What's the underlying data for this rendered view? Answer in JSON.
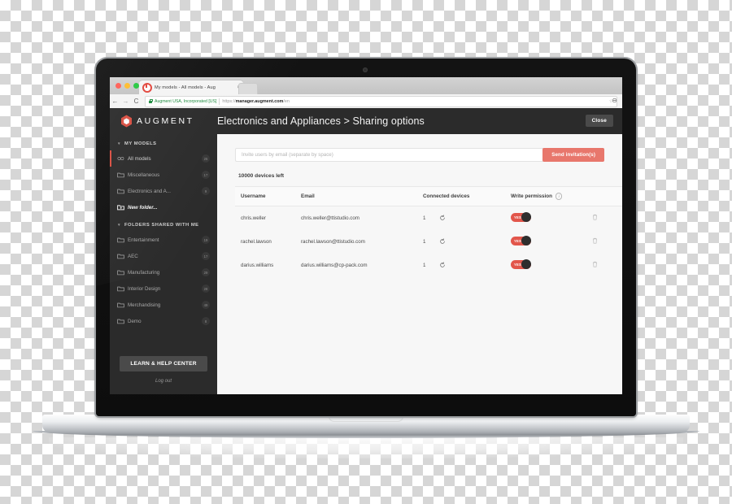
{
  "browser": {
    "tab_title": "My models - All models - Aug",
    "tab_close": "×",
    "back_icon": "←",
    "forward_icon": "→",
    "reload_icon": "C",
    "site_identity": "Augment USA, Incorporated [US]",
    "url_prefix": "https://",
    "url_domain": "manager.augment.com",
    "url_path": "/en",
    "star_icon": "☆",
    "profile_icon": "⊖"
  },
  "topbar": {
    "brand": "AUGMENT",
    "page_title": "Electronics and Appliances > Sharing options",
    "close_label": "Close"
  },
  "sidebar": {
    "sections": [
      {
        "title": "MY MODELS",
        "items": [
          {
            "label": "All models",
            "badge": "25",
            "icon": "infinity-icon",
            "active": true
          },
          {
            "label": "Miscellaneous",
            "badge": "17",
            "icon": "folder-icon",
            "active": false
          },
          {
            "label": "Electronics and A...",
            "badge": "9",
            "icon": "folder-icon",
            "active": false
          },
          {
            "label": "New folder...",
            "badge": "",
            "icon": "folder-plus-icon",
            "active": false,
            "newfolder": true
          }
        ]
      },
      {
        "title": "FOLDERS SHARED WITH ME",
        "items": [
          {
            "label": "Entertainment",
            "badge": "19",
            "icon": "folder-icon",
            "active": false
          },
          {
            "label": "AEC",
            "badge": "17",
            "icon": "folder-icon",
            "active": false
          },
          {
            "label": "Manufacturing",
            "badge": "29",
            "icon": "folder-icon",
            "active": false
          },
          {
            "label": "Interior Design",
            "badge": "28",
            "icon": "folder-icon",
            "active": false
          },
          {
            "label": "Merchandising",
            "badge": "49",
            "icon": "folder-icon",
            "active": false
          },
          {
            "label": "Demo",
            "badge": "8",
            "icon": "folder-icon",
            "active": false
          }
        ]
      }
    ],
    "help_button": "LEARN & HELP CENTER",
    "logout": "Log out"
  },
  "content": {
    "invite_placeholder": "Invite users by email (separate by space)",
    "invite_value": "",
    "send_button": "Send invitation(s)",
    "devices_left": "10000 devices left",
    "table": {
      "columns": {
        "username": "Username",
        "email": "Email",
        "connected_devices": "Connected devices",
        "write_permission": "Write permission",
        "actions": ""
      },
      "rows": [
        {
          "username": "chris.weller",
          "email": "chris.weller@ttistudio.com",
          "devices": "1",
          "permission": "YES",
          "permission_on": true
        },
        {
          "username": "rachel.lawson",
          "email": "rachel.lawson@ttistudio.com",
          "devices": "1",
          "permission": "YES",
          "permission_on": true
        },
        {
          "username": "darius.williams",
          "email": "darius.williams@cp-pack.com",
          "devices": "1",
          "permission": "YES",
          "permission_on": true
        }
      ]
    }
  },
  "colors": {
    "brand_red": "#d94f42",
    "accent_coral": "#e8776c",
    "toggle_on": "#e2564b",
    "sidebar_bg": "#2b2b2b",
    "content_bg": "#f7f7f7"
  }
}
